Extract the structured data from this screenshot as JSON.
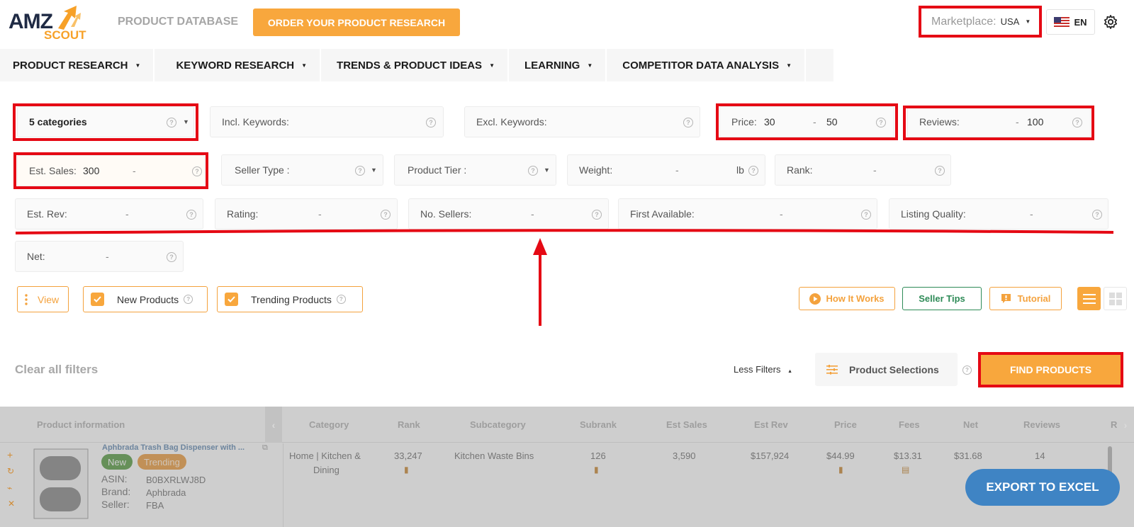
{
  "header": {
    "logo_top": "AMZ",
    "logo_bottom": "SCOUT",
    "product_db_label": "PRODUCT DATABASE",
    "order_button": "ORDER YOUR PRODUCT RESEARCH",
    "marketplace_label": "Marketplace:",
    "marketplace_value": "USA",
    "language": "EN"
  },
  "nav": [
    {
      "label": "PRODUCT RESEARCH"
    },
    {
      "label": "KEYWORD RESEARCH"
    },
    {
      "label": "TRENDS & PRODUCT IDEAS"
    },
    {
      "label": "LEARNING"
    },
    {
      "label": "COMPETITOR DATA ANALYSIS"
    }
  ],
  "filters": {
    "categories": "5  categories",
    "incl_keywords": "Incl. Keywords:",
    "excl_keywords": "Excl. Keywords:",
    "price_label": "Price:",
    "price_min": "30",
    "price_max": "50",
    "reviews_label": "Reviews:",
    "reviews_max": "100",
    "est_sales_label": "Est. Sales:",
    "est_sales_min": "300",
    "seller_type": "Seller Type :",
    "product_tier": "Product Tier :",
    "weight_label": "Weight:",
    "weight_unit": "lb",
    "rank_label": "Rank:",
    "est_rev_label": "Est. Rev:",
    "rating_label": "Rating:",
    "no_sellers_label": "No. Sellers:",
    "first_available_label": "First Available:",
    "listing_quality_label": "Listing Quality:",
    "net_label": "Net:",
    "dash": "-"
  },
  "options": {
    "view": "View",
    "new_products": "New Products",
    "trending_products": "Trending Products",
    "how_it_works": "How It Works",
    "seller_tips": "Seller Tips",
    "tutorial": "Tutorial"
  },
  "actions": {
    "clear_all": "Clear all filters",
    "less_filters": "Less Filters",
    "product_selections": "Product Selections",
    "find_products": "FIND PRODUCTS",
    "export": "EXPORT TO EXCEL"
  },
  "table": {
    "columns": [
      "Product information",
      "Category",
      "Rank",
      "Subcategory",
      "Subrank",
      "Est Sales",
      "Est Rev",
      "Price",
      "Fees",
      "Net",
      "Reviews",
      "R"
    ],
    "row": {
      "title": "Aphbrada Trash Bag Dispenser with ...",
      "badge_new": "New",
      "badge_trending": "Trending",
      "asin_label": "ASIN:",
      "asin": "B0BXRLWJ8D",
      "brand_label": "Brand:",
      "brand": "Aphbrada",
      "seller_label": "Seller:",
      "seller": "FBA",
      "category_line1": "Home | Kitchen &",
      "category_line2": "Dining",
      "rank": "33,247",
      "subcategory": "Kitchen Waste Bins",
      "subrank": "126",
      "est_sales": "3,590",
      "est_rev": "$157,924",
      "price": "$44.99",
      "fees": "$13.31",
      "net": "$31.68",
      "reviews": "14"
    }
  },
  "colors": {
    "accent": "#f8a73d",
    "highlight": "#e50914",
    "export": "#3f84c4",
    "seller_tips": "#2e8b57"
  }
}
